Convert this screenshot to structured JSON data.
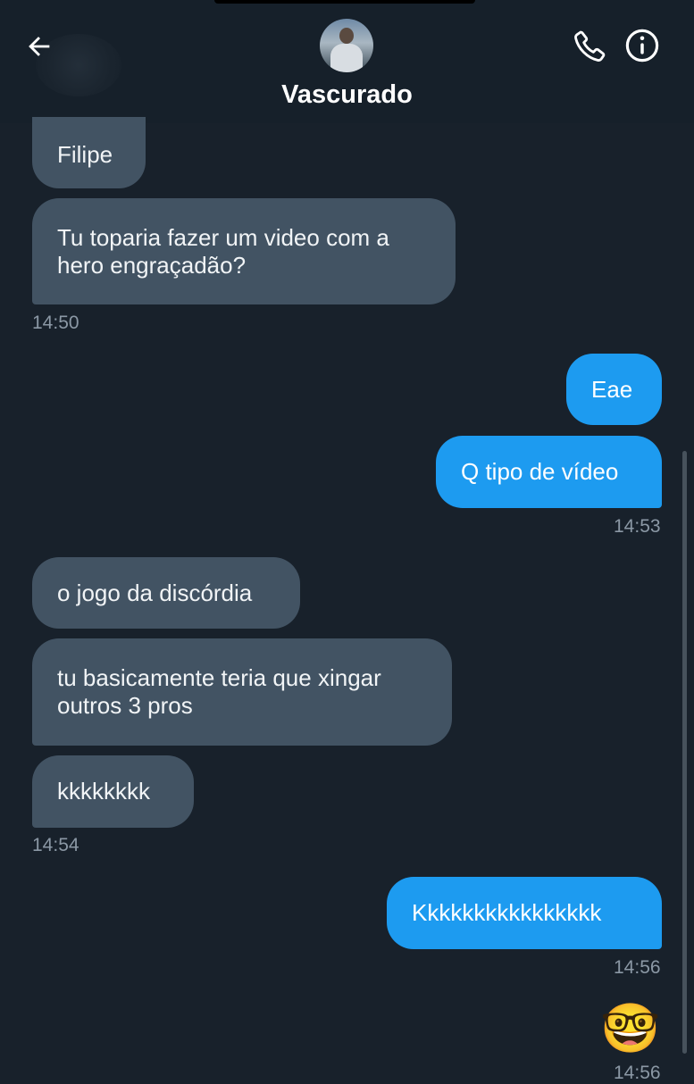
{
  "header": {
    "title": "Vascurado",
    "icons": {
      "back": "arrow-left-icon",
      "call": "phone-icon",
      "info": "info-icon"
    }
  },
  "messages": [
    {
      "from": "them",
      "text": "Filipe"
    },
    {
      "from": "them",
      "text": "Tu toparia fazer um video com a hero engraçadão?"
    },
    {
      "time": "14:50"
    },
    {
      "from": "me",
      "text": "Eae"
    },
    {
      "from": "me",
      "text": "Q tipo de vídeo"
    },
    {
      "time": "14:53"
    },
    {
      "from": "them",
      "text": "o jogo da discórdia"
    },
    {
      "from": "them",
      "text": "tu basicamente teria que xingar outros 3 pros"
    },
    {
      "from": "them",
      "text": "kkkkkkkk"
    },
    {
      "time": "14:54"
    },
    {
      "from": "me",
      "text": "Kkkkkkkkkkkkkkkk"
    },
    {
      "time": "14:56"
    },
    {
      "from": "me",
      "text": "🤓"
    },
    {
      "time": "14:56"
    }
  ],
  "colors": {
    "background": "#18212b",
    "received_bubble": "#425363",
    "sent_bubble": "#1d9bf0",
    "timestamp": "#8b98a5"
  }
}
